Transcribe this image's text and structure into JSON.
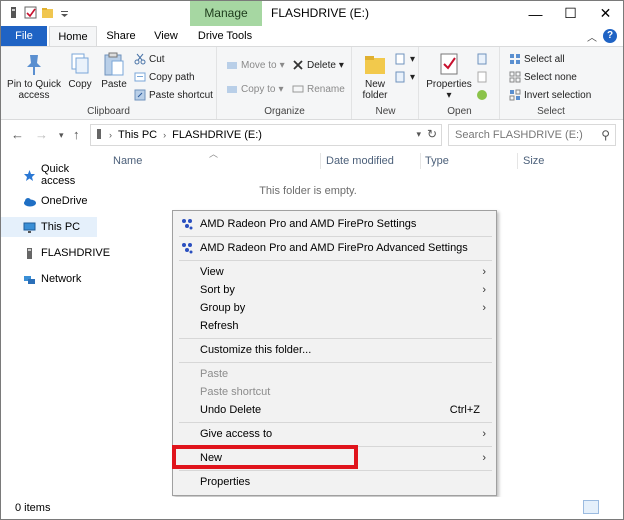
{
  "window": {
    "title": "FLASHDRIVE (E:)",
    "context_tab": "Manage",
    "controls": {
      "minimize": "—",
      "maximize": "☐",
      "close": "✕"
    }
  },
  "ribbon_tabs": [
    "File",
    "Home",
    "Share",
    "View",
    "Drive Tools"
  ],
  "ribbon": {
    "clipboard": {
      "label": "Clipboard",
      "pin": "Pin to Quick access",
      "copy": "Copy",
      "paste": "Paste",
      "cut": "Cut",
      "copy_path": "Copy path",
      "paste_shortcut": "Paste shortcut"
    },
    "organize": {
      "label": "Organize",
      "move_to": "Move to",
      "copy_to": "Copy to",
      "delete": "Delete",
      "rename": "Rename"
    },
    "new": {
      "label": "New",
      "new_folder": "New folder"
    },
    "open": {
      "label": "Open",
      "properties": "Properties"
    },
    "select": {
      "label": "Select",
      "select_all": "Select all",
      "select_none": "Select none",
      "invert": "Invert selection"
    }
  },
  "address": {
    "crumbs": [
      "This PC",
      "FLASHDRIVE (E:)"
    ],
    "search_placeholder": "Search FLASHDRIVE (E:)"
  },
  "nav_pane": [
    {
      "label": "Quick access",
      "icon": "star-icon"
    },
    {
      "label": "OneDrive",
      "icon": "cloud-icon"
    },
    {
      "label": "This PC",
      "icon": "monitor-icon"
    },
    {
      "label": "FLASHDRIVE",
      "icon": "usb-drive-icon"
    },
    {
      "label": "Network",
      "icon": "network-icon"
    }
  ],
  "columns": [
    "Name",
    "Date modified",
    "Type",
    "Size"
  ],
  "empty_message": "This folder is empty.",
  "context_menu": {
    "amd1": "AMD Radeon Pro and AMD FirePro Settings",
    "amd2": "AMD Radeon Pro and AMD FirePro Advanced Settings",
    "view": "View",
    "sort_by": "Sort by",
    "group_by": "Group by",
    "refresh": "Refresh",
    "customize": "Customize this folder...",
    "paste": "Paste",
    "paste_shortcut": "Paste shortcut",
    "undo_delete": "Undo Delete",
    "undo_shortcut": "Ctrl+Z",
    "give_access": "Give access to",
    "new": "New",
    "properties": "Properties"
  },
  "status": {
    "items": "0 items"
  },
  "colors": {
    "accent": "#1f63c4",
    "manage_tab": "#a6d7a2",
    "highlight_box": "#e0141c"
  }
}
